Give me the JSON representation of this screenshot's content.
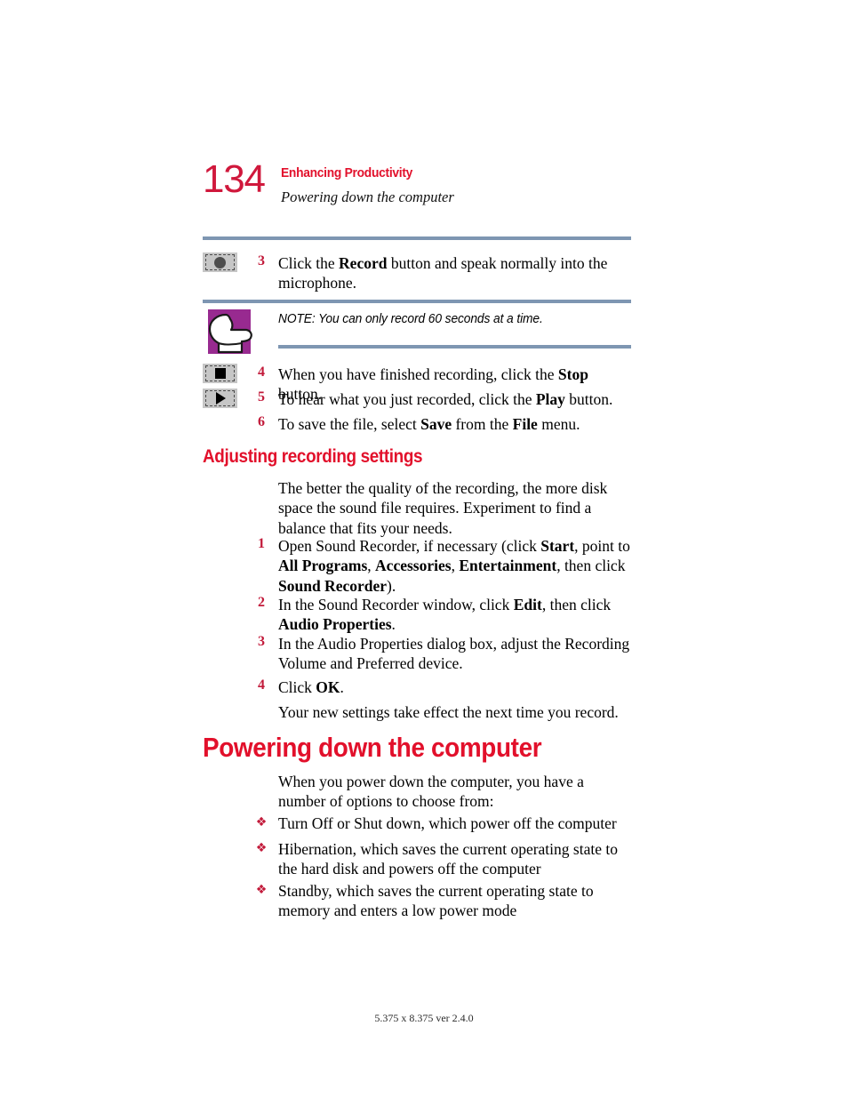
{
  "page": {
    "number": "134",
    "header_title": "Enhancing Productivity",
    "header_subtitle": "Powering down the computer",
    "footer": "5.375 x 8.375 ver 2.4.0"
  },
  "colors": {
    "heading_red": "#e2102b",
    "page_number_red": "#d0183c",
    "step_number_red": "#c21a3a",
    "rule_slate": "#7e96b2",
    "note_icon_purple": "#982a90",
    "button_gray": "#c6c6c6"
  },
  "steps_recording": [
    {
      "number": "3",
      "icon": "record-button-icon",
      "text_html": "Click the <b>Record</b> button and speak normally into the microphone."
    },
    {
      "number": "4",
      "icon": "stop-button-icon",
      "text_html": "When you have finished recording, click the <b>Stop</b> button."
    },
    {
      "number": "5",
      "icon": "play-button-icon",
      "text_html": "To hear what you just recorded, click the <b>Play</b> button."
    },
    {
      "number": "6",
      "icon": "",
      "text_html": "To save the file, select <b>Save</b> from the <b>File</b> menu."
    }
  ],
  "note": {
    "icon": "pointing-hand-icon",
    "text": "NOTE: You can only record 60 seconds at a time."
  },
  "section_adjusting": {
    "heading": "Adjusting recording settings",
    "intro": "The better the quality of the recording, the more disk space the sound file requires. Experiment to find a balance that fits your needs.",
    "steps": [
      {
        "number": "1",
        "text_html": "Open Sound Recorder, if necessary (click <b>Start</b>, point to <b>All Programs</b>, <b>Accessories</b>, <b>Entertainment</b>, then click <b>Sound Recorder</b>)."
      },
      {
        "number": "2",
        "text_html": "In the Sound Recorder window, click <b>Edit</b>, then click <b>Audio Properties</b>."
      },
      {
        "number": "3",
        "text_html": "In the Audio Properties dialog box, adjust the Recording Volume and Preferred device."
      },
      {
        "number": "4",
        "text_html": "Click <b>OK</b>."
      }
    ],
    "closing": "Your new settings take effect the next time you record."
  },
  "section_powering": {
    "heading": "Powering down the computer",
    "intro": "When you power down the computer, you have a number of options to choose from:",
    "bullet_glyph": "❖",
    "bullets": [
      "Turn Off or Shut down, which power off the computer",
      "Hibernation, which saves the current operating state to the hard disk and powers off the computer",
      "Standby, which saves the current operating state to memory and enters a low power mode"
    ]
  }
}
